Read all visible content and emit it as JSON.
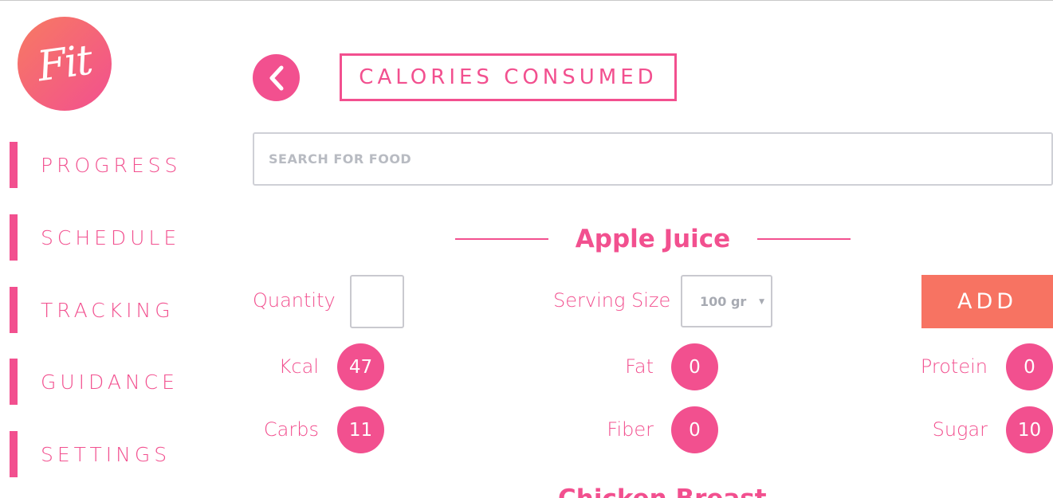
{
  "logo": {
    "text": "Fit"
  },
  "sidebar": {
    "items": [
      {
        "label": "PROGRESS"
      },
      {
        "label": "SCHEDULE"
      },
      {
        "label": "TRACKING"
      },
      {
        "label": "GUIDANCE"
      },
      {
        "label": "SETTINGS"
      }
    ]
  },
  "header": {
    "title": "CALORIES CONSUMED",
    "back_icon": "chevron-left-icon"
  },
  "search": {
    "placeholder": "SEARCH FOR FOOD",
    "value": ""
  },
  "food": {
    "name": "Apple Juice",
    "quantity_label": "Quantity",
    "quantity_value": "",
    "serving_label": "Serving Size",
    "serving_value": "100 gr",
    "add_label": "ADD",
    "nutrients": {
      "kcal": {
        "label": "Kcal",
        "value": "47"
      },
      "fat": {
        "label": "Fat",
        "value": "0"
      },
      "protein": {
        "label": "Protein",
        "value": "0"
      },
      "carbs": {
        "label": "Carbs",
        "value": "11"
      },
      "fiber": {
        "label": "Fiber",
        "value": "0"
      },
      "sugar": {
        "label": "Sugar",
        "value": "10"
      }
    }
  },
  "next_food": {
    "name": "Chicken Breast"
  },
  "colors": {
    "accent": "#f2508f",
    "add_button": "#f77362",
    "logo_gradient_start": "#f77a62"
  }
}
